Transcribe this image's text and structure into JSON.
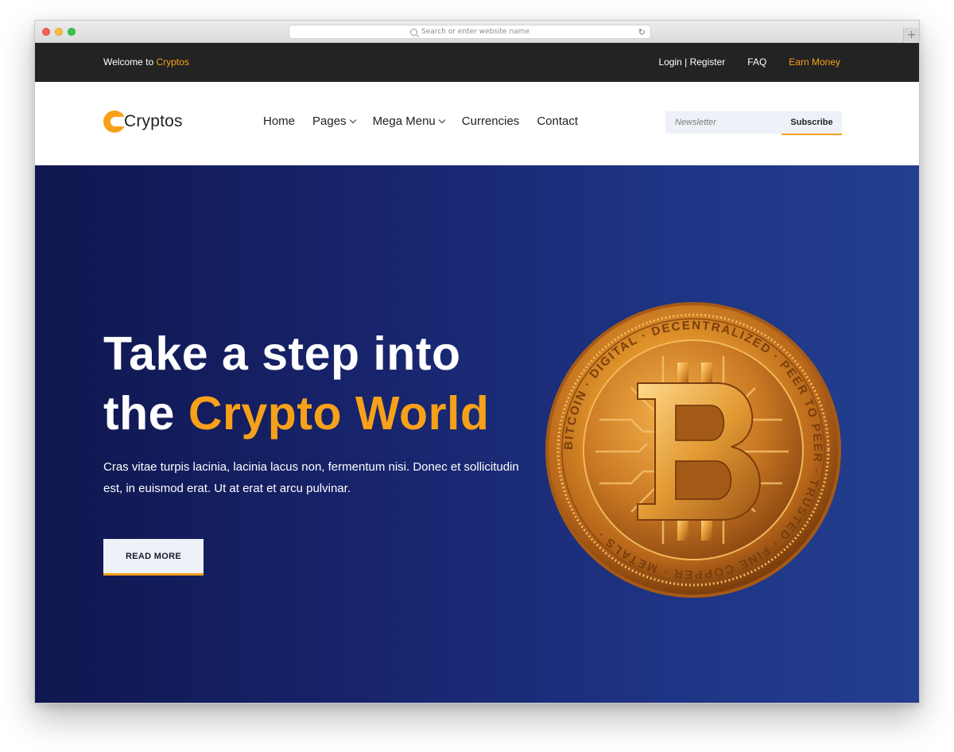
{
  "browser": {
    "address_placeholder": "Search or enter website name"
  },
  "topbar": {
    "welcome_prefix": "Welcome to ",
    "welcome_brand": "Cryptos",
    "links": [
      "Login | Register",
      "FAQ",
      "Earn Money"
    ]
  },
  "header": {
    "logo_text": "Cryptos",
    "nav": [
      {
        "label": "Home"
      },
      {
        "label": "Pages"
      },
      {
        "label": "Mega Menu"
      },
      {
        "label": "Currencies"
      },
      {
        "label": "Contact"
      }
    ],
    "newsletter_placeholder": "Newsletter",
    "subscribe_label": "Subscribe"
  },
  "hero": {
    "title_line1": "Take a step into",
    "title_line2_prefix": "the ",
    "title_line2_accent": "Crypto World",
    "description": "Cras vitae turpis lacinia, lacinia lacus non, fermentum nisi. Donec et sollicitudin est, in euismod erat. Ut at erat et arcu pulvinar.",
    "button_label": "READ MORE",
    "coin_ring_text": "BITCOIN · DIGITAL · DECENTRALIZED · PEER TO PEER · TRUSTED · FINE COPPER · METALS ·"
  },
  "colors": {
    "accent": "#f7a11a",
    "topbar_bg": "#232323",
    "hero_dark": "#10174f",
    "hero_light": "#243f8f"
  },
  "icons": [
    "search-icon",
    "reload-icon",
    "chevron-down-icon",
    "bitcoin-coin-icon"
  ]
}
